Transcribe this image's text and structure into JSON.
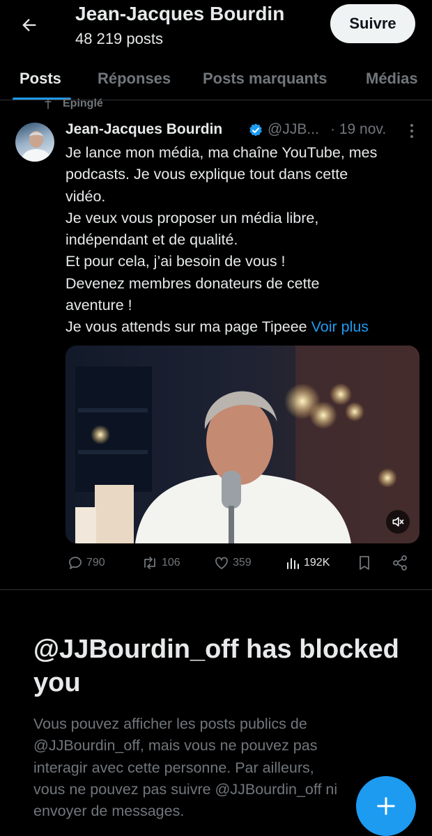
{
  "header": {
    "title": "Jean-Jacques Bourdin",
    "posts_count": "48 219 posts",
    "follow_label": "Suivre"
  },
  "tabs": [
    {
      "label": "Posts",
      "active": true
    },
    {
      "label": "Réponses",
      "active": false
    },
    {
      "label": "Posts marquants",
      "active": false
    },
    {
      "label": "Médias",
      "active": false
    }
  ],
  "pinned_label": "Épinglé",
  "tweet": {
    "author_name": "Jean-Jacques Bourdin",
    "handle": "@JJB...",
    "date": "· 19 nov.",
    "text_lines": [
      "Je lance mon média, ma chaîne YouTube, mes",
      "podcasts. Je vous explique tout dans cette",
      "vidéo.",
      "Je veux vous proposer un média libre,",
      "indépendant et de qualité.",
      "Et pour cela, j’ai besoin de vous !",
      "Devenez membres donateurs de cette",
      "aventure !",
      "Je vous attends sur ma page Tipeee"
    ],
    "see_more": "Voir plus",
    "stats": {
      "replies": "790",
      "reposts": "106",
      "likes": "359",
      "views": "192K"
    }
  },
  "blocked": {
    "title": "@JJBourdin_off has blocked you",
    "body_lines": [
      "Vous pouvez afficher les posts publics de",
      "@JJBourdin_off, mais vous ne pouvez pas",
      "interagir avec cette personne. Par ailleurs,",
      "vous ne pouvez pas suivre @JJBourdin_off ni",
      "envoyer de messages."
    ]
  },
  "colors": {
    "accent": "#1d9bf0",
    "background": "#000000",
    "text_primary": "#e7e9ea",
    "text_secondary": "#71767b"
  },
  "icons": {
    "back": "arrow-left-icon",
    "verified": "verified-badge-icon",
    "more": "more-vertical-icon",
    "reply": "comment-icon",
    "repost": "repost-icon",
    "like": "heart-icon",
    "views": "views-chart-icon",
    "bookmark": "bookmark-icon",
    "share": "share-icon",
    "mute": "volume-muted-icon",
    "compose": "plus-icon"
  }
}
